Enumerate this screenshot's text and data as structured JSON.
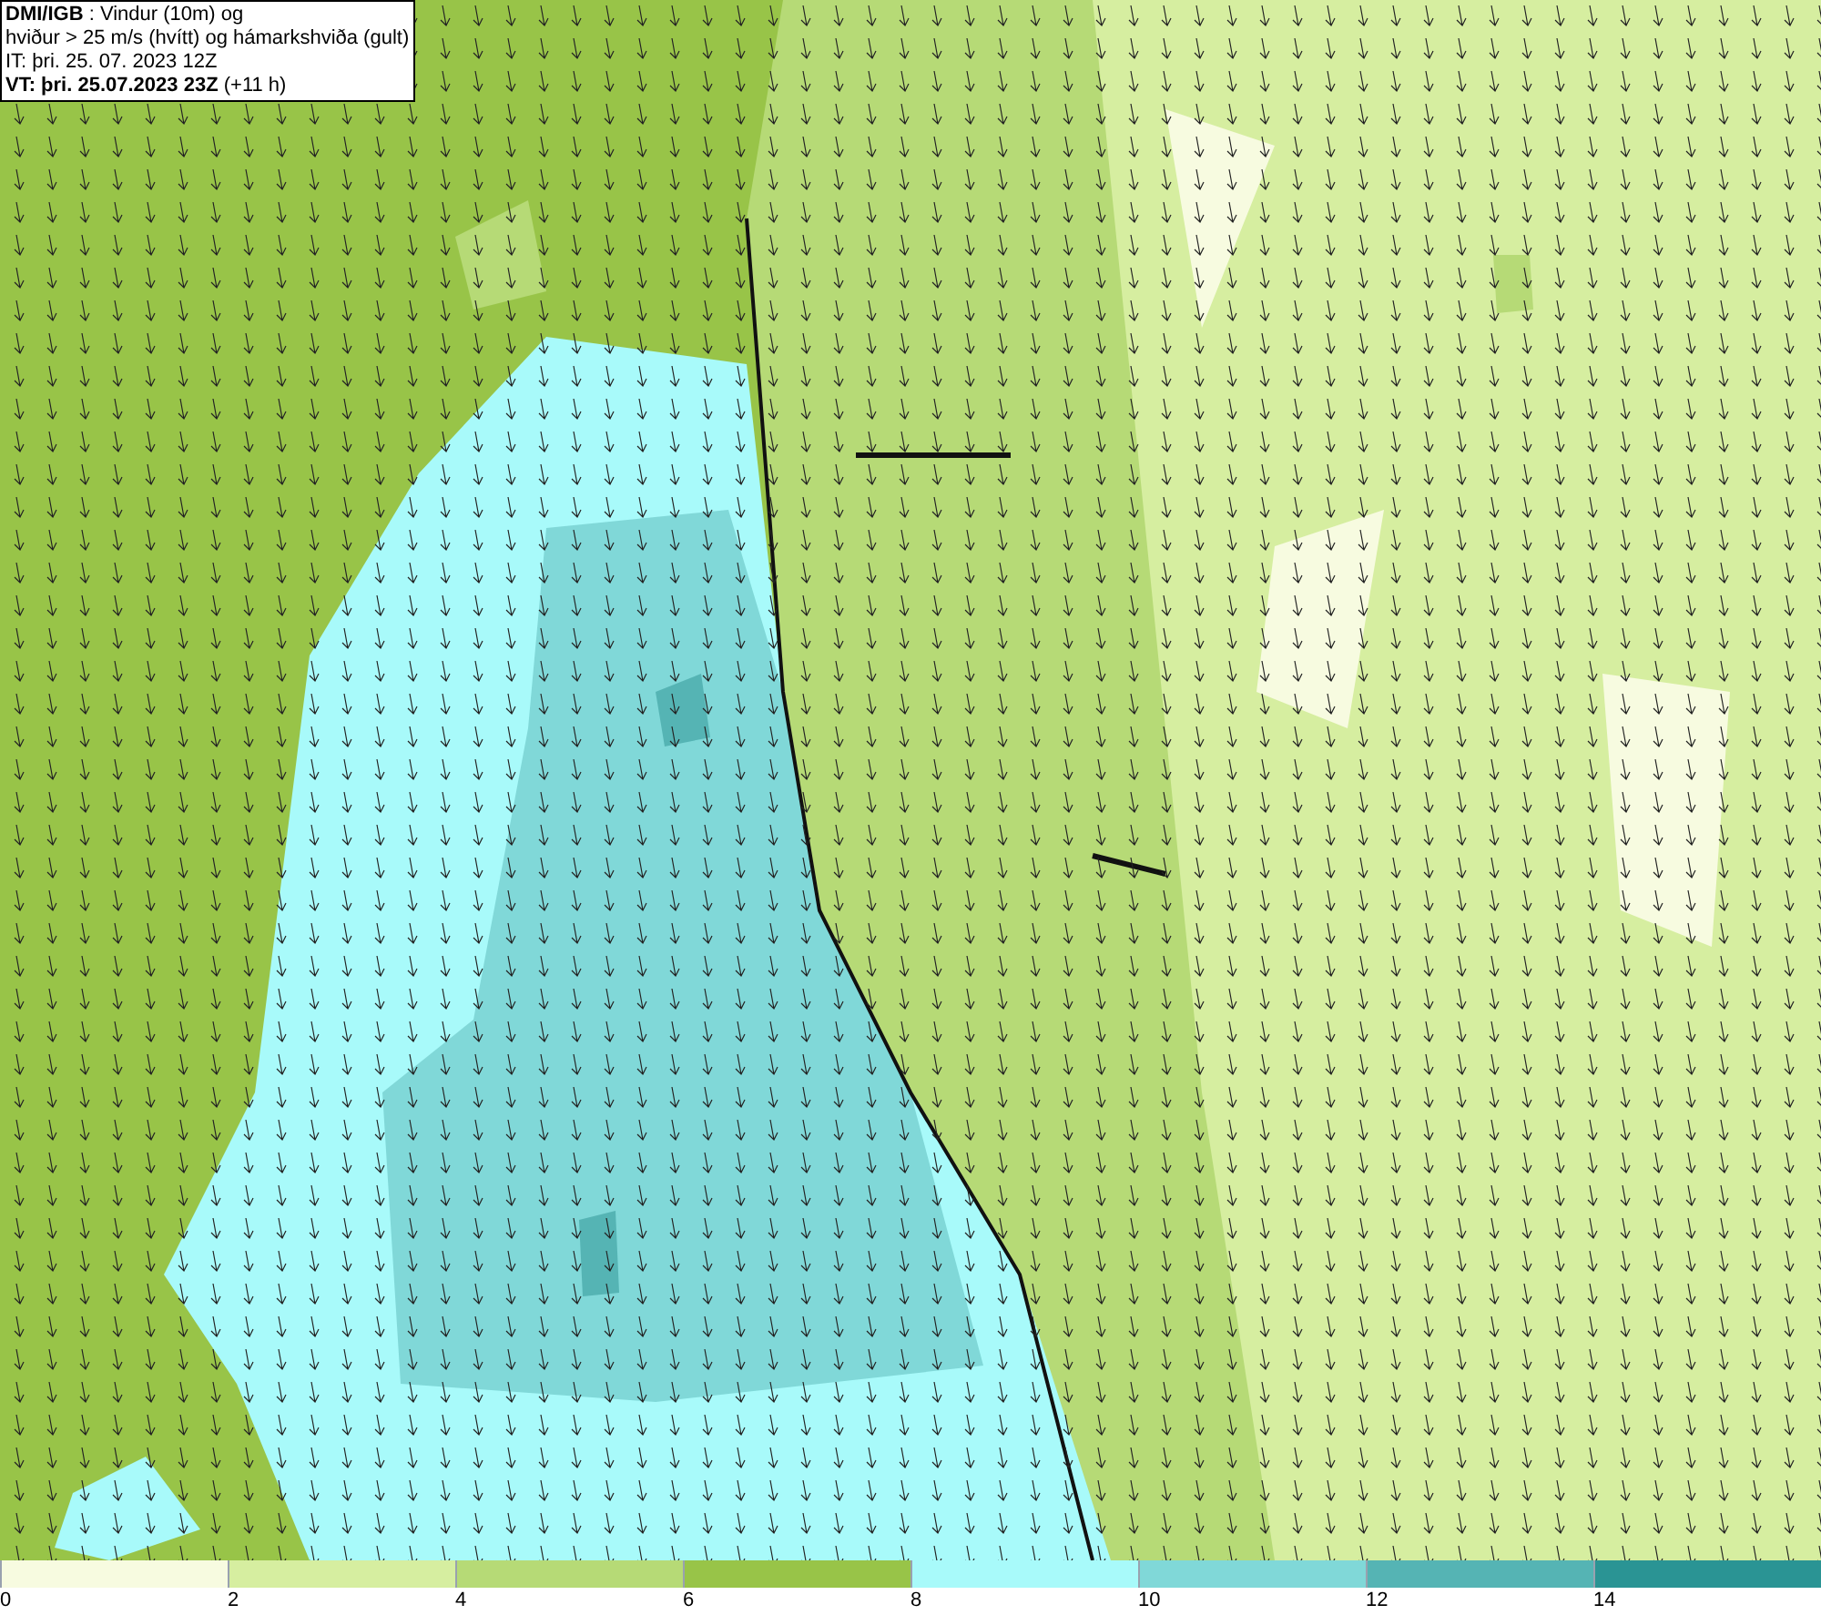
{
  "header": {
    "lines": [
      "**DMI/IGB** : Vindur (10m) og",
      "hviður > 25 m/s (hvítt) og hámarkshviða (gult)",
      "IT: þri. 25. 07. 2023 12Z",
      "**VT: þri. 25.07.2023 23Z** (+11 h)"
    ]
  },
  "legend": [
    {
      "label": "0",
      "color": "#f7fbe0"
    },
    {
      "label": "2",
      "color": "#d6eea0"
    },
    {
      "label": "4",
      "color": "#b6da76"
    },
    {
      "label": "6",
      "color": "#98c448"
    },
    {
      "label": "8",
      "color": "#a8fafa"
    },
    {
      "label": "10",
      "color": "#80d8d8"
    },
    {
      "label": "12",
      "color": "#55b4b4"
    },
    {
      "label": "14",
      "color": "#2a9494"
    }
  ]
}
